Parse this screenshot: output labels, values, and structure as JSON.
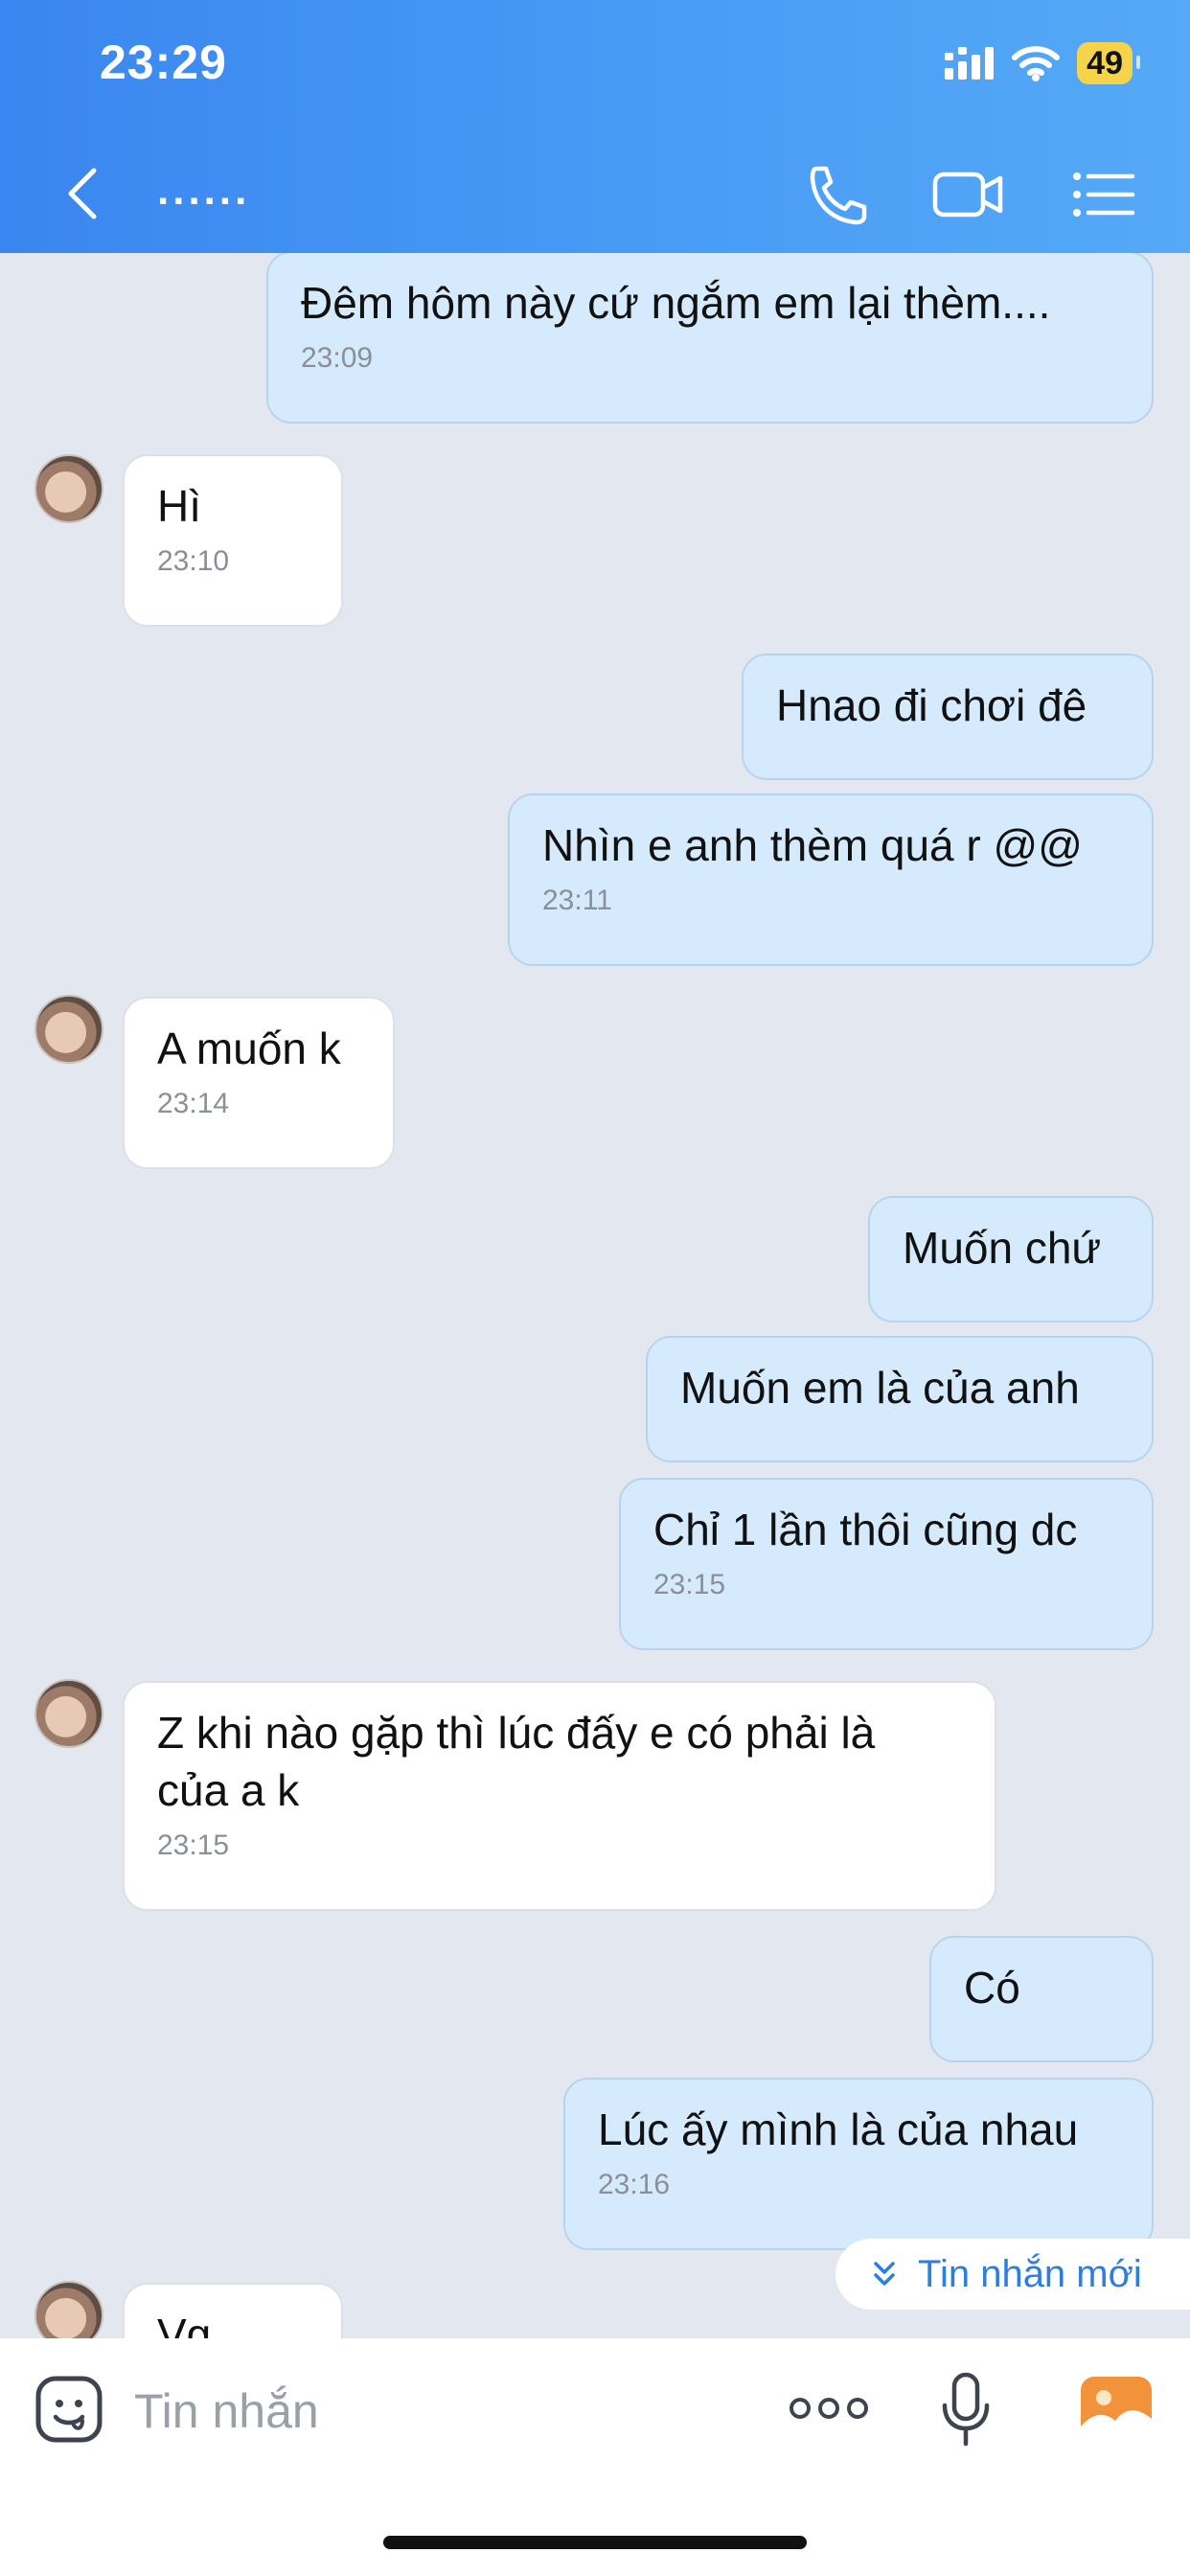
{
  "status_bar": {
    "time": "23:29",
    "battery": "49"
  },
  "header": {
    "title": "......"
  },
  "messages": [
    {
      "dir": "out",
      "text": "Đêm hôm này cứ ngắm em lại thèm....",
      "time": "23:09"
    },
    {
      "dir": "in",
      "text": "Hì",
      "time": "23:10"
    },
    {
      "dir": "out",
      "text": "Hnao đi chơi đê",
      "time": ""
    },
    {
      "dir": "out",
      "text": "Nhìn e anh thèm quá r @@",
      "time": "23:11"
    },
    {
      "dir": "in",
      "text": "A muốn k",
      "time": "23:14"
    },
    {
      "dir": "out",
      "text": "Muốn chứ",
      "time": ""
    },
    {
      "dir": "out",
      "text": "Muốn em là của anh",
      "time": ""
    },
    {
      "dir": "out",
      "text": "Chỉ 1 lần thôi cũng dc",
      "time": "23:15"
    },
    {
      "dir": "in",
      "text": "Z khi nào gặp thì lúc đấy e có phải là\ncủa a k",
      "time": "23:15"
    },
    {
      "dir": "out",
      "text": "Có",
      "time": ""
    },
    {
      "dir": "out",
      "text": "Lúc ấy mình là của nhau",
      "time": "23:16"
    },
    {
      "dir": "in",
      "text": "Vg",
      "time": ""
    }
  ],
  "new_messages_label": "Tin nhắn mới",
  "input": {
    "placeholder": "Tin nhắn",
    "value": ""
  },
  "icons": {
    "back": "chevron-left-icon",
    "call": "phone-icon",
    "video": "video-camera-icon",
    "menu": "list-menu-icon",
    "sticker": "sticker-face-icon",
    "more": "more-dots-icon",
    "mic": "microphone-icon",
    "gallery": "gallery-image-icon"
  },
  "colors": {
    "header": "#3a86f0",
    "outgoing_bubble": "#d5ebfd",
    "incoming_bubble": "#ffffff",
    "accent": "#2a7fe0"
  }
}
